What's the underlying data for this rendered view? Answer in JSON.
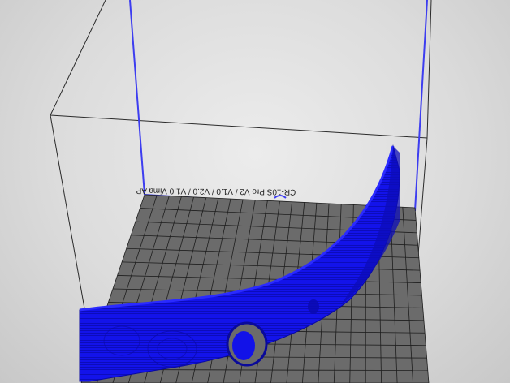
{
  "viewer": {
    "bed_label": "CR-10S Pro V2 / V1.0 / V2.0 / V1.0 Vima AP",
    "part_color": "#1010e6",
    "bed_color": "#6b6b6b",
    "frame_blue": "#3d3df0"
  }
}
